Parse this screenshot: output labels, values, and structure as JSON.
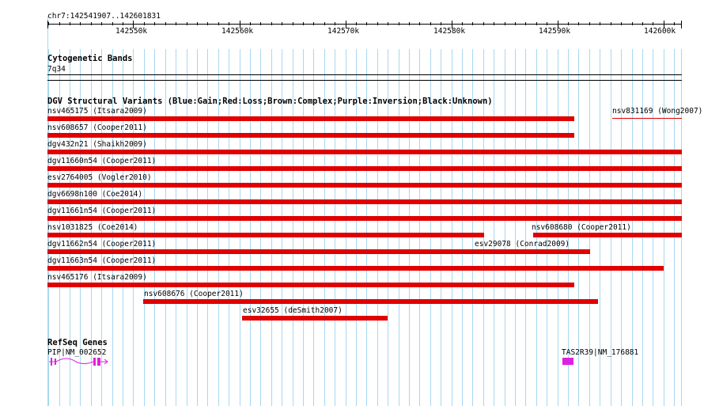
{
  "location": "chr7:142541907..142601831",
  "ruler": {
    "ticks": [
      "142550k",
      "142560k",
      "142570k",
      "142580k",
      "142590k",
      "142600k"
    ]
  },
  "cytoband": {
    "title": "Cytogenetic Bands",
    "band": "7q34"
  },
  "dgv": {
    "title": "DGV Structural Variants (Blue:Gain;Red:Loss;Brown:Complex;Purple:Inversion;Black:Unknown)",
    "color_loss": "#e00000",
    "variants": [
      {
        "label": "nsv465175 (Itsara2009)",
        "start": 142541907,
        "end": 142591600
      },
      {
        "label": "nsv831169 (Wong2007)",
        "start": 142595200,
        "end": 142601831
      },
      {
        "label": "nsv608657 (Cooper2011)",
        "start": 142541907,
        "end": 142591600
      },
      {
        "label": "dgv432n21 (Shaikh2009)",
        "start": 142541907,
        "end": 142601831
      },
      {
        "label": "dgv11660n54 (Cooper2011)",
        "start": 142541907,
        "end": 142601831
      },
      {
        "label": "esv2764005 (Vogler2010)",
        "start": 142541907,
        "end": 142601831
      },
      {
        "label": "dgv6698n100 (Coe2014)",
        "start": 142541907,
        "end": 142601831
      },
      {
        "label": "dgv11661n54 (Cooper2011)",
        "start": 142541907,
        "end": 142601831
      },
      {
        "label": "nsv1031825 (Coe2014)",
        "start": 142541907,
        "end": 142583100
      },
      {
        "label": "nsv608680 (Cooper2011)",
        "start": 142587700,
        "end": 142601831
      },
      {
        "label": "dgv11662n54 (Cooper2011)",
        "start": 142541907,
        "end": 142582300
      },
      {
        "label": "esv29078 (Conrad2009)",
        "start": 142582300,
        "end": 142593100
      },
      {
        "label": "dgv11663n54 (Cooper2011)",
        "start": 142541907,
        "end": 142600000
      },
      {
        "label": "nsv465176 (Itsara2009)",
        "start": 142541907,
        "end": 142591600
      },
      {
        "label": "nsv608676 (Cooper2011)",
        "start": 142550950,
        "end": 142593800
      },
      {
        "label": "esv32655 (deSmith2007)",
        "start": 142560250,
        "end": 142574000
      }
    ]
  },
  "refseq": {
    "title": "RefSeq Genes",
    "gene_color": "#e020e0",
    "genes": [
      {
        "label": "PIP|NM_002652",
        "start": 142542000,
        "end": 142547500
      },
      {
        "label": "TAS2R39|NM_176881",
        "start": 142590500,
        "end": 142591500
      }
    ]
  }
}
